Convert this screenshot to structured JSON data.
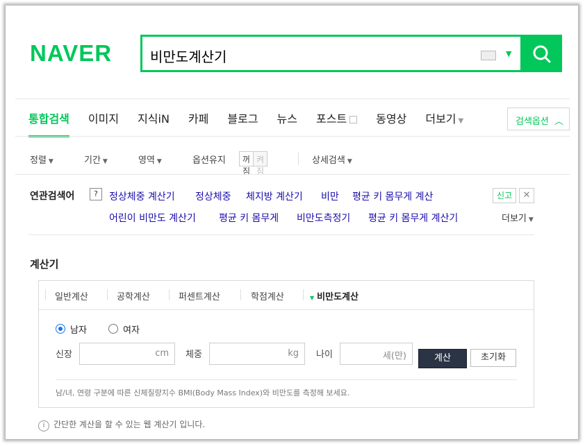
{
  "header": {
    "logo": "NAVER",
    "search_value": "비만도계산기"
  },
  "tabs": [
    {
      "label": "통합검색"
    },
    {
      "label": "이미지"
    },
    {
      "label": "지식iN"
    },
    {
      "label": "카페"
    },
    {
      "label": "블로그"
    },
    {
      "label": "뉴스"
    },
    {
      "label": "포스트"
    },
    {
      "label": "동영상"
    },
    {
      "label": "더보기"
    }
  ],
  "search_options_label": "검색옵션",
  "filters": {
    "sort": "정렬",
    "period": "기간",
    "area": "영역",
    "keep_option": "옵션유지",
    "keep_on": "꺼짐",
    "keep_off": "켜짐",
    "detail": "상세검색"
  },
  "related": {
    "title": "연관검색어",
    "help": "?",
    "items": [
      "정상체중 계산기",
      "정상체중",
      "체지방 계산기",
      "비만",
      "평균 키 몸무게 계산",
      "어린이 비만도 계산기",
      "평균 키 몸무게",
      "비만도측정기",
      "평균 키 몸무게 계산기"
    ],
    "report": "신고",
    "close": "✕",
    "more": "더보기"
  },
  "calculator": {
    "title": "계산기",
    "tabs": [
      "일반계산",
      "공학계산",
      "퍼센트계산",
      "학점계산",
      "비만도계산"
    ],
    "gender_male": "남자",
    "gender_female": "여자",
    "height_label": "신장",
    "height_unit": "cm",
    "weight_label": "체중",
    "weight_unit": "kg",
    "age_label": "나이",
    "age_unit": "세(만)",
    "calc_button": "계산",
    "reset_button": "초기화",
    "description": "남/녀, 연령 구분에 따른 신체질량지수 BMI(Body Mass Index)와 비만도를 측정해 보세요.",
    "footer": "간단한 계산을 할 수 있는 웹 계산기 입니다.",
    "info_icon": "i"
  },
  "colors": {
    "brand": "#03c75a",
    "link": "#1a0dab"
  }
}
